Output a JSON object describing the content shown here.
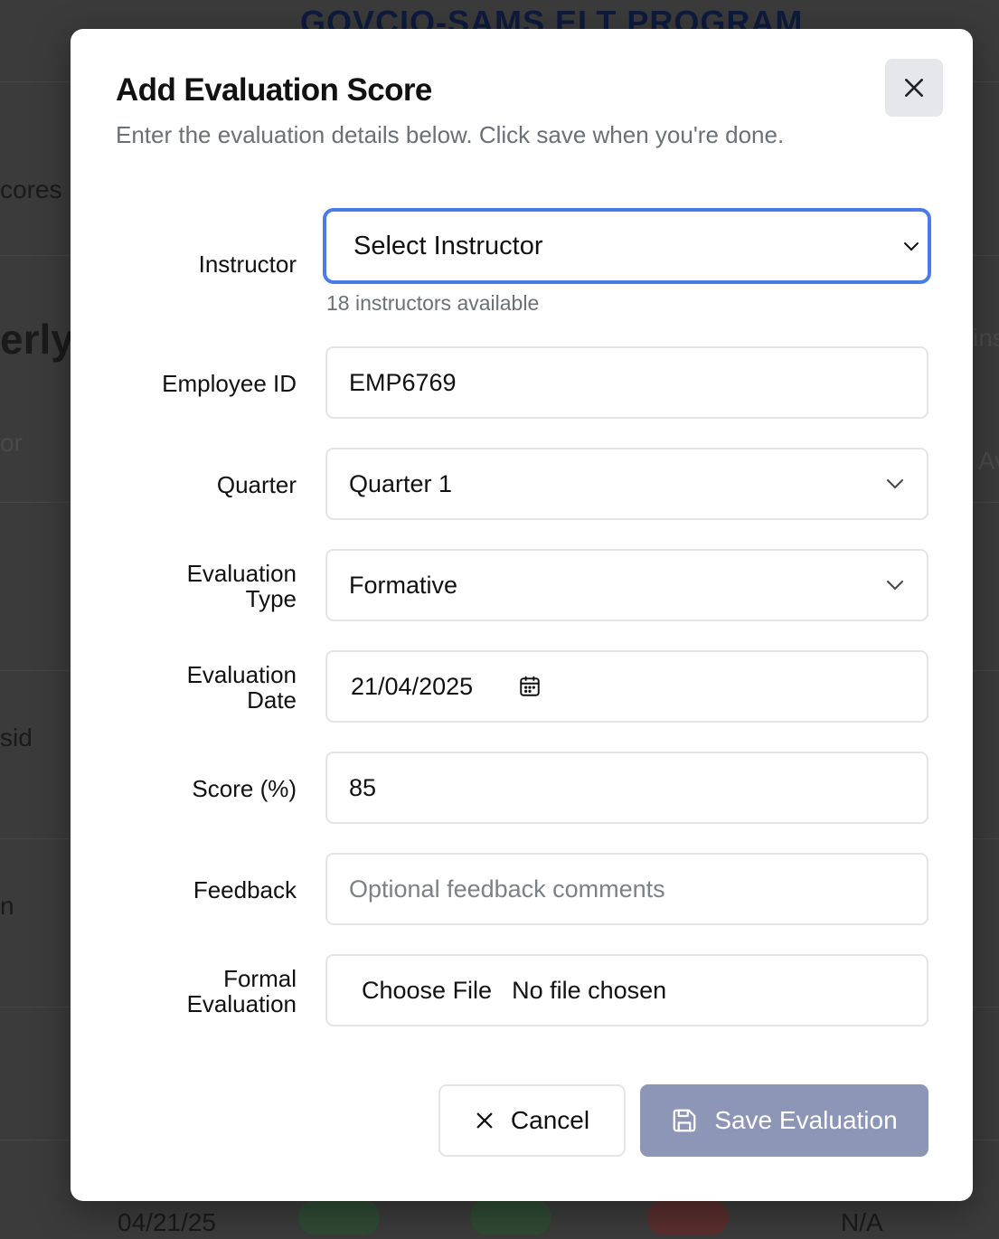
{
  "background": {
    "app_title": "GOVCIO-SAMS ELT PROGRAM",
    "fragments": {
      "scores_tab": "cores",
      "quarterly_heading": "erly I",
      "ins": "ins",
      "instructor_col": "or",
      "av": "Av",
      "sid": "sid",
      "n": "n",
      "row_date": "04/21/25",
      "row_na": "N/A"
    }
  },
  "modal": {
    "title": "Add Evaluation Score",
    "description": "Enter the evaluation details below. Click save when you're done.",
    "close_label": "Close",
    "fields": {
      "instructor": {
        "label": "Instructor",
        "value": "Select Instructor",
        "hint": "18 instructors available"
      },
      "employee_id": {
        "label": "Employee ID",
        "value": "EMP6769"
      },
      "quarter": {
        "label": "Quarter",
        "value": "Quarter 1"
      },
      "evaluation_type": {
        "label_line1": "Evaluation",
        "label_line2": "Type",
        "value": "Formative"
      },
      "evaluation_date": {
        "label_line1": "Evaluation",
        "label_line2": "Date",
        "value": "21/04/2025"
      },
      "score": {
        "label": "Score (%)",
        "value": "85"
      },
      "feedback": {
        "label": "Feedback",
        "placeholder": "Optional feedback comments"
      },
      "formal_evaluation": {
        "label_line1": "Formal",
        "label_line2": "Evaluation",
        "button": "Choose File",
        "status": "No file chosen"
      }
    },
    "buttons": {
      "cancel": "Cancel",
      "save": "Save Evaluation"
    }
  },
  "colors": {
    "focus_ring": "#4b7be5",
    "save_button": "#8d96b6",
    "overlay": "#3b3b3b"
  },
  "icons": {
    "close": "x-icon",
    "select_chevron": "chevron-down-icon",
    "calendar": "calendar-icon",
    "cancel": "x-icon",
    "save": "save-icon"
  }
}
